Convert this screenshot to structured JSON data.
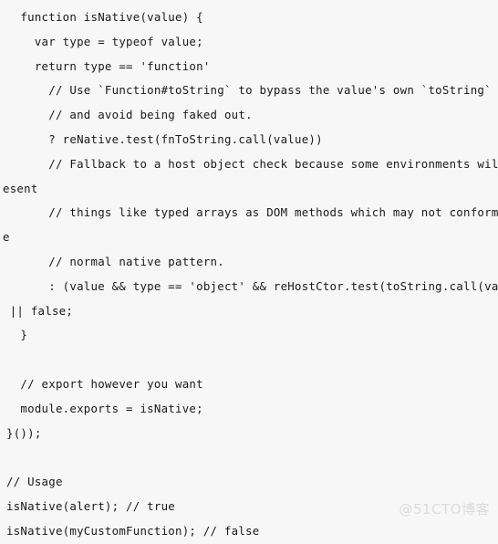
{
  "document": {
    "kind": "code-snippet-screenshot",
    "language": "javascript",
    "background_color": "#f7f7f7",
    "text_color": "#1a1a1a"
  },
  "code": {
    "lines": [
      {
        "text": "  function isNative(value) {",
        "wrapped": false
      },
      {
        "text": "    var type = typeof value;",
        "wrapped": false
      },
      {
        "text": "    return type == 'function'",
        "wrapped": false
      },
      {
        "text": "      // Use `Function#toString` to bypass the value's own `toString` method",
        "wrapped": false
      },
      {
        "text": "      // and avoid being faked out.",
        "wrapped": false
      },
      {
        "text": "      ? reNative.test(fnToString.call(value))",
        "wrapped": false
      },
      {
        "text": "      // Fallback to a host object check because some environments will repr",
        "wrapped": false
      },
      {
        "text": "esent",
        "wrapped": true
      },
      {
        "text": "      // things like typed arrays as DOM methods which may not conform to th",
        "wrapped": false
      },
      {
        "text": "e",
        "wrapped": true
      },
      {
        "text": "      // normal native pattern.",
        "wrapped": false
      },
      {
        "text": "      : (value && type == 'object' && reHostCtor.test(toString.call(value)))",
        "wrapped": false
      },
      {
        "text": " || false;",
        "wrapped": true
      },
      {
        "text": "  }",
        "wrapped": false
      },
      {
        "text": "",
        "wrapped": false
      },
      {
        "text": "  // export however you want",
        "wrapped": false
      },
      {
        "text": "  module.exports = isNative;",
        "wrapped": false
      },
      {
        "text": "}());",
        "wrapped": false
      },
      {
        "text": "",
        "wrapped": false
      },
      {
        "text": "// Usage",
        "wrapped": false
      },
      {
        "text": "isNative(alert); // true",
        "wrapped": false
      },
      {
        "text": "isNative(myCustomFunction); // false",
        "wrapped": false
      }
    ]
  },
  "watermark": {
    "text": "@51CTO博客",
    "color": "#dcdcdc"
  }
}
